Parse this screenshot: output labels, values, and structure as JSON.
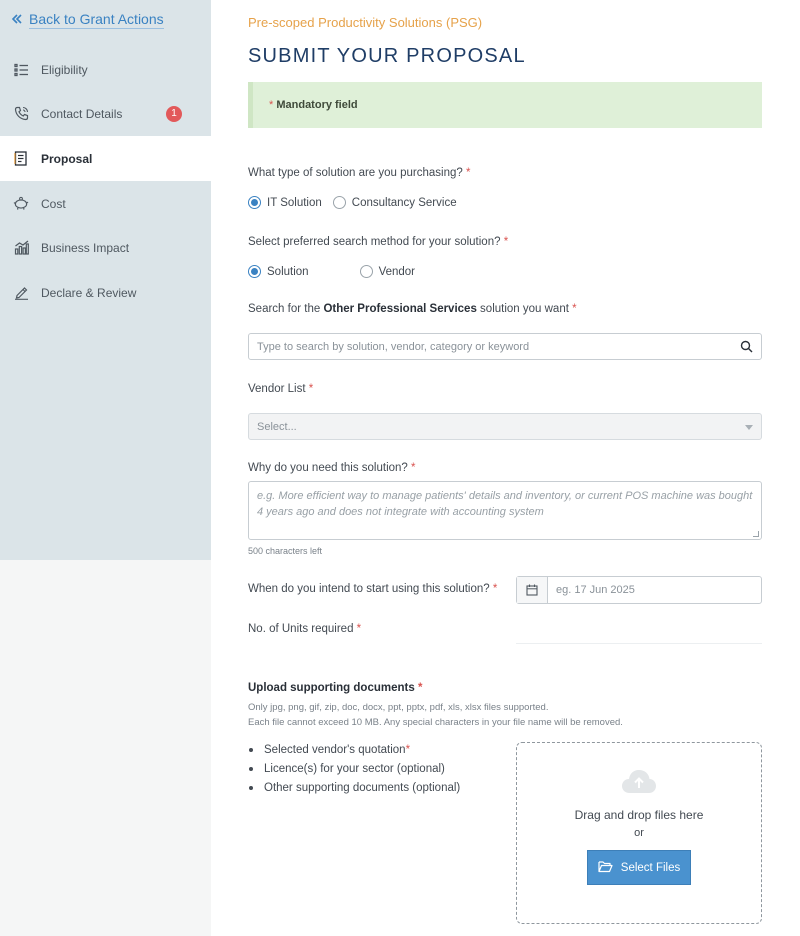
{
  "sidebar": {
    "back_label": "Back to Grant Actions",
    "items": [
      {
        "label": "Eligibility",
        "icon": "list-icon"
      },
      {
        "label": "Contact Details",
        "icon": "phone-icon",
        "badge": "1"
      },
      {
        "label": "Proposal",
        "icon": "document-icon",
        "active": true
      },
      {
        "label": "Cost",
        "icon": "piggy-bank-icon"
      },
      {
        "label": "Business Impact",
        "icon": "bar-chart-icon"
      },
      {
        "label": "Declare & Review",
        "icon": "pen-icon"
      }
    ]
  },
  "header": {
    "subtitle": "Pre-scoped Productivity Solutions (PSG)",
    "title": "SUBMIT YOUR PROPOSAL"
  },
  "alert": {
    "asterisk": "*",
    "text": "Mandatory field"
  },
  "form": {
    "required_mark": "*",
    "solution_type": {
      "label": "What type of solution are you purchasing?",
      "options": [
        "IT Solution",
        "Consultancy Service"
      ],
      "selected": "IT Solution"
    },
    "search_method": {
      "label": "Select preferred search method for your solution?",
      "options": [
        "Solution",
        "Vendor"
      ],
      "selected": "Solution"
    },
    "search": {
      "label_prefix": "Search for the",
      "label_bold": "Other Professional Services",
      "label_suffix": "solution you want",
      "placeholder": "Type to search by solution, vendor, category or keyword"
    },
    "vendor": {
      "label": "Vendor List",
      "placeholder": "Select..."
    },
    "reason": {
      "label": "Why do you need this solution?",
      "placeholder": "e.g. More efficient way to manage patients' details and inventory, or current POS machine was bought 4 years ago and does not integrate with accounting system",
      "chars_left": "500 characters left"
    },
    "start_date": {
      "label": "When do you intend to start using this solution?",
      "placeholder": "eg. 17 Jun 2025"
    },
    "units": {
      "label": "No. of Units required"
    }
  },
  "upload": {
    "title": "Upload supporting documents",
    "note_1": "Only jpg, png, gif, zip, doc, docx, ppt, pptx, pdf, xls, xlsx files supported.",
    "note_2": "Each file cannot exceed 10 MB. Any special characters in your file name will be removed.",
    "docs": [
      {
        "text": "Selected vendor's quotation",
        "required": true
      },
      {
        "text": "Licence(s) for your sector (optional)",
        "required": false
      },
      {
        "text": "Other supporting documents (optional)",
        "required": false
      }
    ],
    "drop_text": "Drag and drop files here",
    "or_text": "or",
    "button_label": "Select Files"
  },
  "colors": {
    "accent": "#3a82c2",
    "title": "#1f3d66",
    "subtitle": "#e6a24a",
    "required": "#d9534f",
    "alert_bg": "#dff0d8"
  }
}
